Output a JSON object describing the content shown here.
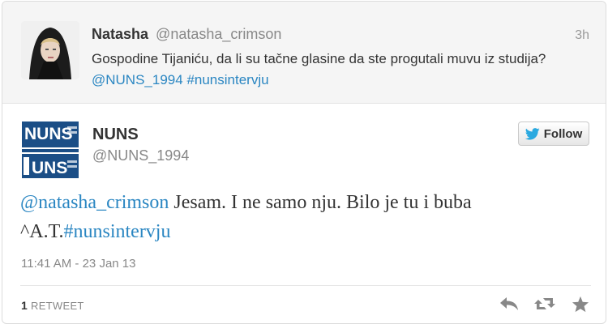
{
  "reply": {
    "name": "Natasha",
    "handle": "@natasha_crimson",
    "time": "3h",
    "text_part1": "Gospodine Tijaniću, da li su tačne glasine da ste progutali muvu iz studija?",
    "mention": "@NUNS_1994",
    "hashtag": "#nunsintervju"
  },
  "tweet": {
    "name": "NUNS",
    "handle": "@NUNS_1994",
    "follow_label": "Follow",
    "mention": "@natasha_crimson",
    "text_part1": "Jesam. I ne samo nju. Bilo je tu i buba ^A.T.",
    "hashtag": "#nunsintervju",
    "timestamp": "11:41 AM - 23 Jan 13"
  },
  "stats": {
    "retweet_count": "1",
    "retweet_label": "RETWEET"
  },
  "logo": {
    "line1": "NUNS",
    "line2": "UNS"
  },
  "icons": [
    "twitter-bird-icon",
    "reply-icon",
    "retweet-icon",
    "favorite-star-icon"
  ],
  "colors": {
    "link": "#2a86c2",
    "nuns_blue": "#1b4e86"
  }
}
